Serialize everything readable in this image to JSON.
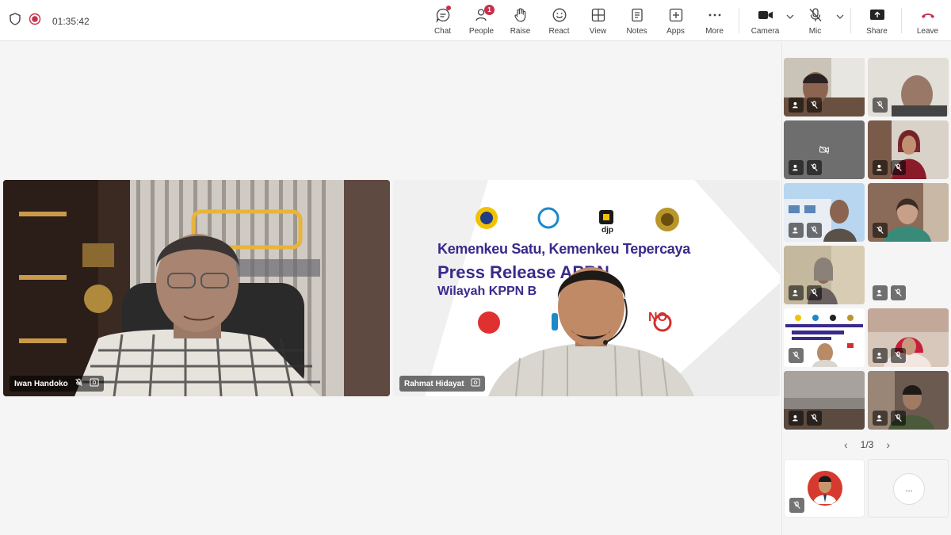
{
  "status": {
    "timer": "01:35:42"
  },
  "toolbar": {
    "chat": "Chat",
    "people": "People",
    "people_badge": "1",
    "raise": "Raise",
    "react": "React",
    "view": "View",
    "notes": "Notes",
    "apps": "Apps",
    "more": "More",
    "camera": "Camera",
    "mic": "Mic",
    "share": "Share",
    "leave": "Leave"
  },
  "main_videos": [
    {
      "name": "Iwan Handoko"
    },
    {
      "name": "Rahmat Hidayat"
    }
  ],
  "slide": {
    "line1": "Kemenkeu Satu, Kemenkeu Tepercaya",
    "line2": "Press Release APBN",
    "line3": "Wilayah KPPN B",
    "logo_djp": "djp",
    "no_mark": "NO"
  },
  "pager": {
    "label": "1/3"
  },
  "overflow": {
    "label": "..."
  },
  "colors": {
    "leave": "#c4314b",
    "record": "#c4314b",
    "badge": "#c4314b"
  }
}
